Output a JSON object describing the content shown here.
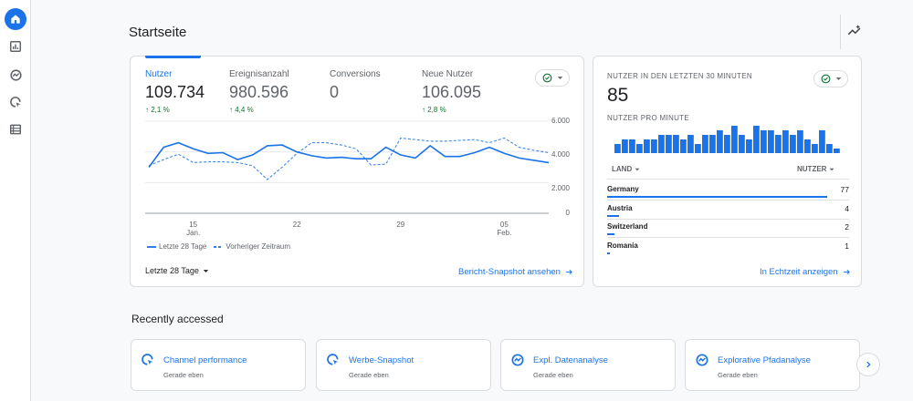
{
  "nav": {
    "items": [
      {
        "name": "home",
        "icon": "home-icon"
      },
      {
        "name": "reports",
        "icon": "bar-chart-icon"
      },
      {
        "name": "explore",
        "icon": "explore-icon"
      },
      {
        "name": "advertising",
        "icon": "advertising-icon"
      },
      {
        "name": "configure",
        "icon": "list-icon"
      }
    ]
  },
  "page": {
    "title": "Startseite"
  },
  "overview": {
    "metrics": [
      {
        "label": "Nutzer",
        "value": "109.734",
        "delta": "2,1 %",
        "active": true
      },
      {
        "label": "Ereignisanzahl",
        "value": "980.596",
        "delta": "4,4 %",
        "active": false
      },
      {
        "label": "Conversions",
        "value": "0",
        "delta": "",
        "active": false
      },
      {
        "label": "Neue Nutzer",
        "value": "106.095",
        "delta": "2,8 %",
        "active": false
      }
    ],
    "legend": {
      "current": "Letzte 28 Tage",
      "previous": "Vorheriger Zeitraum"
    },
    "date_range": "Letzte 28 Tage",
    "link": "Bericht-Snapshot ansehen"
  },
  "chart_data": {
    "type": "line",
    "y_ticks": [
      "6.000",
      "4.000",
      "2.000",
      "0"
    ],
    "ylim": [
      0,
      6000
    ],
    "x_ticks": [
      {
        "index": 3,
        "day": "15",
        "month": "Jan."
      },
      {
        "index": 10,
        "day": "22",
        "month": ""
      },
      {
        "index": 17,
        "day": "29",
        "month": ""
      },
      {
        "index": 24,
        "day": "05",
        "month": "Feb."
      }
    ],
    "series": [
      {
        "name": "Letzte 28 Tage",
        "color": "#1a73e8",
        "dashed": false,
        "values": [
          3000,
          4300,
          4600,
          4200,
          3900,
          3950,
          3500,
          3800,
          4400,
          4450,
          4000,
          3750,
          3600,
          3650,
          3550,
          3550,
          4300,
          3800,
          3600,
          4400,
          3700,
          3700,
          3950,
          4300,
          3900,
          3600,
          3450,
          3300
        ]
      },
      {
        "name": "Vorheriger Zeitraum",
        "color": "#1a73e8",
        "dashed": true,
        "values": [
          3100,
          3500,
          3850,
          3300,
          3350,
          3350,
          3300,
          3100,
          2200,
          3000,
          3900,
          4600,
          4600,
          4450,
          4200,
          3150,
          3200,
          4900,
          4800,
          4700,
          4700,
          4750,
          4800,
          4600,
          4900,
          4300,
          4100,
          3950
        ]
      }
    ]
  },
  "realtime": {
    "title": "NUTZER IN DEN LETZTEN 30 MINUTEN",
    "value": "85",
    "per_minute_label": "NUTZER PRO MINUTE",
    "per_minute": [
      2,
      3,
      3,
      2,
      3,
      3,
      4,
      4,
      4,
      3,
      4,
      2,
      4,
      4,
      5,
      4,
      6,
      4,
      3,
      6,
      5,
      5,
      4,
      5,
      4,
      5,
      3,
      2,
      5,
      2,
      1
    ],
    "col_country": "LAND",
    "col_users": "NUTZER",
    "rows": [
      {
        "country": "Germany",
        "users": "77",
        "share": 0.91
      },
      {
        "country": "Austria",
        "users": "4",
        "share": 0.05
      },
      {
        "country": "Switzerland",
        "users": "2",
        "share": 0.03
      },
      {
        "country": "Romania",
        "users": "1",
        "share": 0.012
      }
    ],
    "link": "In Echtzeit anzeigen"
  },
  "recent": {
    "title": "Recently accessed",
    "items": [
      {
        "title": "Channel performance",
        "subtitle": "Gerade eben",
        "icon": "advertising-icon"
      },
      {
        "title": "Werbe-Snapshot",
        "subtitle": "Gerade eben",
        "icon": "advertising-icon"
      },
      {
        "title": "Expl. Datenanalyse",
        "subtitle": "Gerade eben",
        "icon": "explore-icon"
      },
      {
        "title": "Explorative Pfadanalyse",
        "subtitle": "Gerade eben",
        "icon": "explore-icon"
      }
    ]
  },
  "colors": {
    "accent": "#1a73e8",
    "positive": "#137333"
  }
}
